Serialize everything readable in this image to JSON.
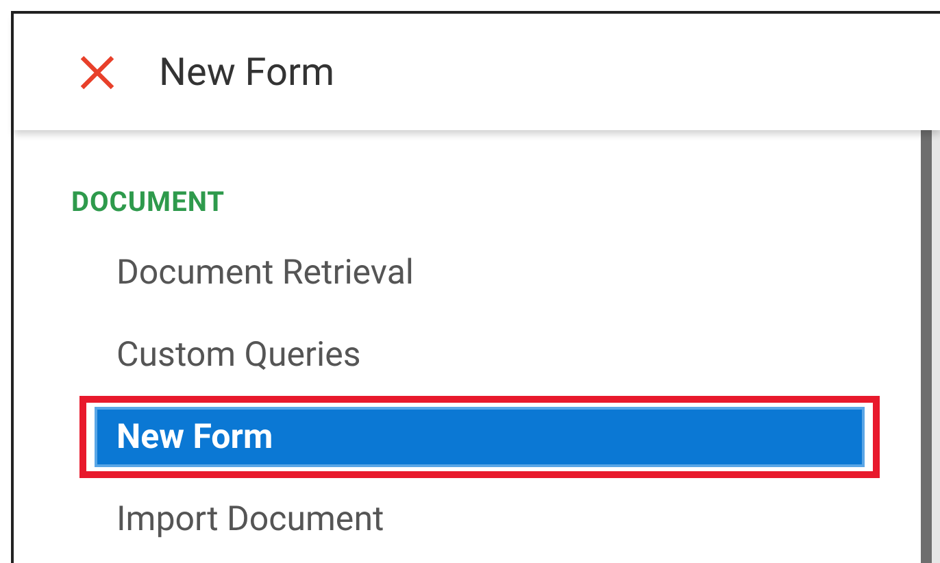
{
  "header": {
    "title": "New Form"
  },
  "section": {
    "heading": "DOCUMENT",
    "items": [
      {
        "label": "Document Retrieval",
        "selected": false,
        "highlighted": false
      },
      {
        "label": "Custom Queries",
        "selected": false,
        "highlighted": false
      },
      {
        "label": "New Form",
        "selected": true,
        "highlighted": true
      },
      {
        "label": "Import Document",
        "selected": false,
        "highlighted": false
      }
    ]
  }
}
